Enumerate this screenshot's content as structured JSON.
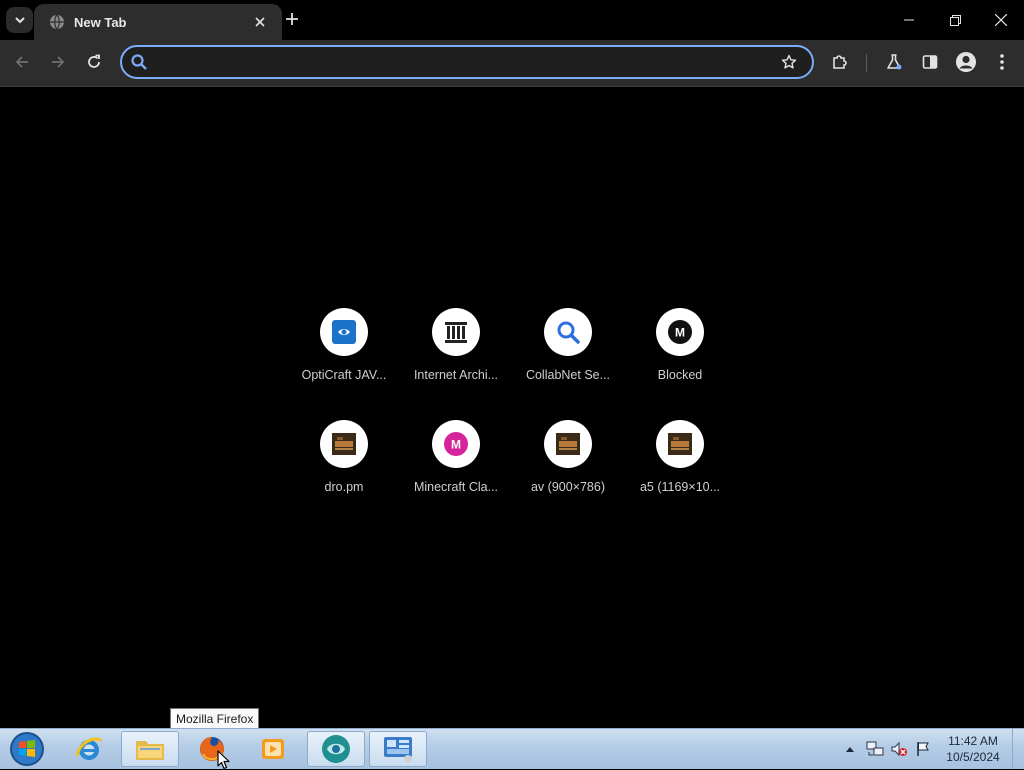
{
  "browser": {
    "tab_title": "New Tab",
    "omnibox": {
      "value": "",
      "placeholder": ""
    },
    "accent": "#7cacf8"
  },
  "shortcuts": [
    {
      "label": "OptiCraft JAV...",
      "icon": "opticraft-icon"
    },
    {
      "label": "Internet Archi...",
      "icon": "archive-icon"
    },
    {
      "label": "CollabNet Se...",
      "icon": "search-icon"
    },
    {
      "label": "Blocked",
      "icon": "m-letter-icon"
    },
    {
      "label": "dro.pm",
      "icon": "dropm-icon"
    },
    {
      "label": "Minecraft Cla...",
      "icon": "m-letter-icon"
    },
    {
      "label": "av (900×786)",
      "icon": "dropm-icon"
    },
    {
      "label": "a5 (1169×10...",
      "icon": "dropm-icon"
    }
  ],
  "shortcut_letters": {
    "blocked": "M",
    "minecraft": "M"
  },
  "taskbar": {
    "tooltip": "Mozilla Firefox",
    "time": "11:42 AM",
    "date": "10/5/2024"
  }
}
